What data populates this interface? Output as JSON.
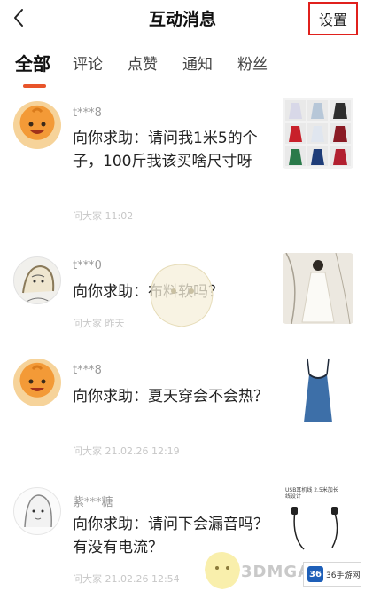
{
  "header": {
    "title": "互动消息",
    "settings_label": "设置"
  },
  "tabs": [
    {
      "label": "全部",
      "active": true
    },
    {
      "label": "评论",
      "active": false
    },
    {
      "label": "点赞",
      "active": false
    },
    {
      "label": "通知",
      "active": false
    },
    {
      "label": "粉丝",
      "active": false
    }
  ],
  "accent_color": "#e8542a",
  "highlight_color": "#e0201c",
  "messages": [
    {
      "user": "t***8",
      "question": "向你求助：请问我1米5的个子，100斤我该买啥尺寸呀",
      "meta": "问大家  11:02",
      "avatar": "orange-character-avatar",
      "thumb": "dress-collage-thumbnail"
    },
    {
      "user": "t***0",
      "question": "向你求助：布料软吗？",
      "meta": "问大家  昨天",
      "avatar": "sketch-girl-avatar",
      "thumb": "white-dress-thumbnail"
    },
    {
      "user": "t***8",
      "question": "向你求助：夏天穿会不会热？",
      "meta": "问大家  21.02.26 12:19",
      "avatar": "orange-character-avatar",
      "thumb": "blue-camisole-thumbnail"
    },
    {
      "user": "紫***糖",
      "question": "向你求助：请问下会漏音吗？有没有电流？",
      "meta": "问大家  21.02.26 12:54",
      "avatar": "sketch-girl-avatar",
      "thumb": "earphones-thumbnail"
    }
  ],
  "watermarks": {
    "site": "3DMGAME",
    "brand_icon": "36",
    "brand": "36手游网"
  },
  "earphone_ad_text": "USB耳机线 2.5米加长线设计"
}
